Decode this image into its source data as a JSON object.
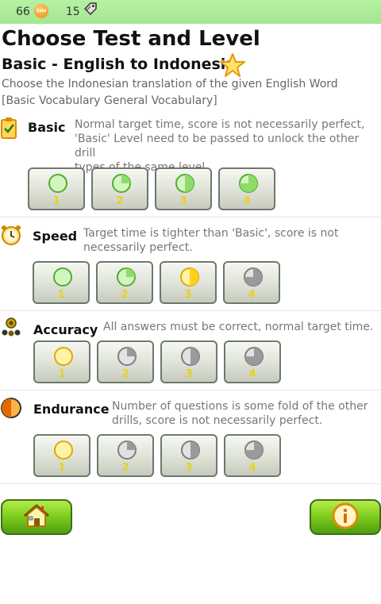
{
  "status_bar": {
    "coins": "66",
    "coin_icon": "coin-icon",
    "coin_label": "Gold",
    "tags": "15",
    "tag_icon": "tag-icon"
  },
  "page": {
    "title": "Choose Test and Level",
    "subtitle": "Basic - English to Indonesia",
    "description": "Choose the Indonesian translation of the given English Word",
    "category": "[Basic Vocabulary General Vocabulary]"
  },
  "sections": [
    {
      "title": "Basic",
      "icon": "clipboard-check-icon",
      "description_lines": [
        "Normal target time, score is not necessarily perfect,",
        "'Basic' Level need to be passed to unlock the other drill",
        "types of the same level."
      ],
      "levels": [
        {
          "label": "1",
          "state": "green",
          "fill": 0
        },
        {
          "label": "2",
          "state": "green",
          "fill": 0.25
        },
        {
          "label": "3",
          "state": "green",
          "fill": 0.5
        },
        {
          "label": "4",
          "state": "green",
          "fill": 0.75
        }
      ]
    },
    {
      "title": "Speed",
      "icon": "alarm-clock-icon",
      "description_lines": [
        "Target time is tighter than 'Basic', score is not",
        "necessarily perfect."
      ],
      "levels": [
        {
          "label": "1",
          "state": "green",
          "fill": 0
        },
        {
          "label": "2",
          "state": "green",
          "fill": 0.25
        },
        {
          "label": "3",
          "state": "yellow",
          "fill": 0.5
        },
        {
          "label": "4",
          "state": "gray",
          "fill": 0.75
        }
      ]
    },
    {
      "title": "Accuracy",
      "icon": "target-people-icon",
      "description_lines": [
        "All answers must be correct, normal target time."
      ],
      "levels": [
        {
          "label": "1",
          "state": "yellow",
          "fill": 0
        },
        {
          "label": "2",
          "state": "gray",
          "fill": 0.25
        },
        {
          "label": "3",
          "state": "gray",
          "fill": 0.5
        },
        {
          "label": "4",
          "state": "gray",
          "fill": 0.75
        }
      ]
    },
    {
      "title": "Endurance",
      "icon": "half-circle-icon",
      "description_lines": [
        "Number of questions is some fold of the other",
        "drills, score is not necessarily perfect."
      ],
      "levels": [
        {
          "label": "1",
          "state": "yellow",
          "fill": 0
        },
        {
          "label": "2",
          "state": "gray",
          "fill": 0.25
        },
        {
          "label": "3",
          "state": "gray",
          "fill": 0.5
        },
        {
          "label": "4",
          "state": "gray",
          "fill": 0.75
        }
      ]
    }
  ],
  "buttons": {
    "home_icon": "home-icon",
    "info_icon": "info-icon"
  },
  "colors": {
    "green_fill": "#8fdc6a",
    "green_stroke": "#4fae2c",
    "green_bg": "#d4f5c2",
    "yellow_fill": "#ffd21a",
    "yellow_stroke": "#e0a800",
    "yellow_bg": "#fff3a8",
    "gray_fill": "#9a9a9a",
    "gray_stroke": "#7d7d7d",
    "gray_bg": "#e2e2e2",
    "accent_green": "#7ccb1e"
  }
}
